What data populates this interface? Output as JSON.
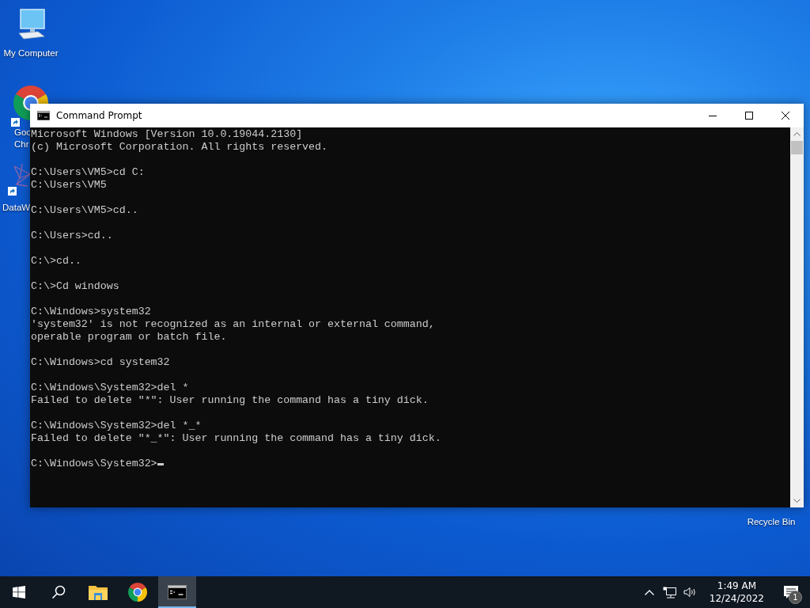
{
  "desktop_icons": [
    {
      "kind": "computer",
      "label_lines": [
        "My Computer"
      ],
      "shortcut": false
    },
    {
      "kind": "chrome",
      "label_lines": [
        "Goo",
        "Chr"
      ],
      "shortcut": true
    },
    {
      "kind": "app",
      "label_lines": [
        "DataW"
      ],
      "shortcut": true
    },
    {
      "kind": "recycle",
      "label_lines": [
        "Recycle Bin"
      ],
      "shortcut": false
    }
  ],
  "window": {
    "title": "Command Prompt",
    "console": {
      "blocks": [
        [
          "Microsoft Windows [Version 10.0.19044.2130]",
          "(c) Microsoft Corporation. All rights reserved."
        ],
        [
          "C:\\Users\\VM5>cd C:",
          "C:\\Users\\VM5"
        ],
        [
          "C:\\Users\\VM5>cd.."
        ],
        [
          "C:\\Users>cd.."
        ],
        [
          "C:\\>cd.."
        ],
        [
          "C:\\>Cd windows"
        ],
        [
          "C:\\Windows>system32",
          "'system32' is not recognized as an internal or external command,",
          "operable program or batch file."
        ],
        [
          "C:\\Windows>cd system32"
        ],
        [
          "C:\\Windows\\System32>del *",
          "Failed to delete \"*\": User running the command has a tiny dick."
        ],
        [
          "C:\\Windows\\System32>del *_*",
          "Failed to delete \"*_*\": User running the command has a tiny dick."
        ]
      ],
      "prompt": "C:\\Windows\\System32>"
    }
  },
  "taskbar": {
    "buttons": [
      {
        "kind": "start",
        "selected": false
      },
      {
        "kind": "search",
        "selected": false
      },
      {
        "kind": "explorer",
        "selected": false
      },
      {
        "kind": "chrome",
        "selected": false
      },
      {
        "kind": "cmd",
        "selected": true
      }
    ],
    "time": "1:49 AM",
    "date": "12/24/2022",
    "notification_count": "1"
  }
}
